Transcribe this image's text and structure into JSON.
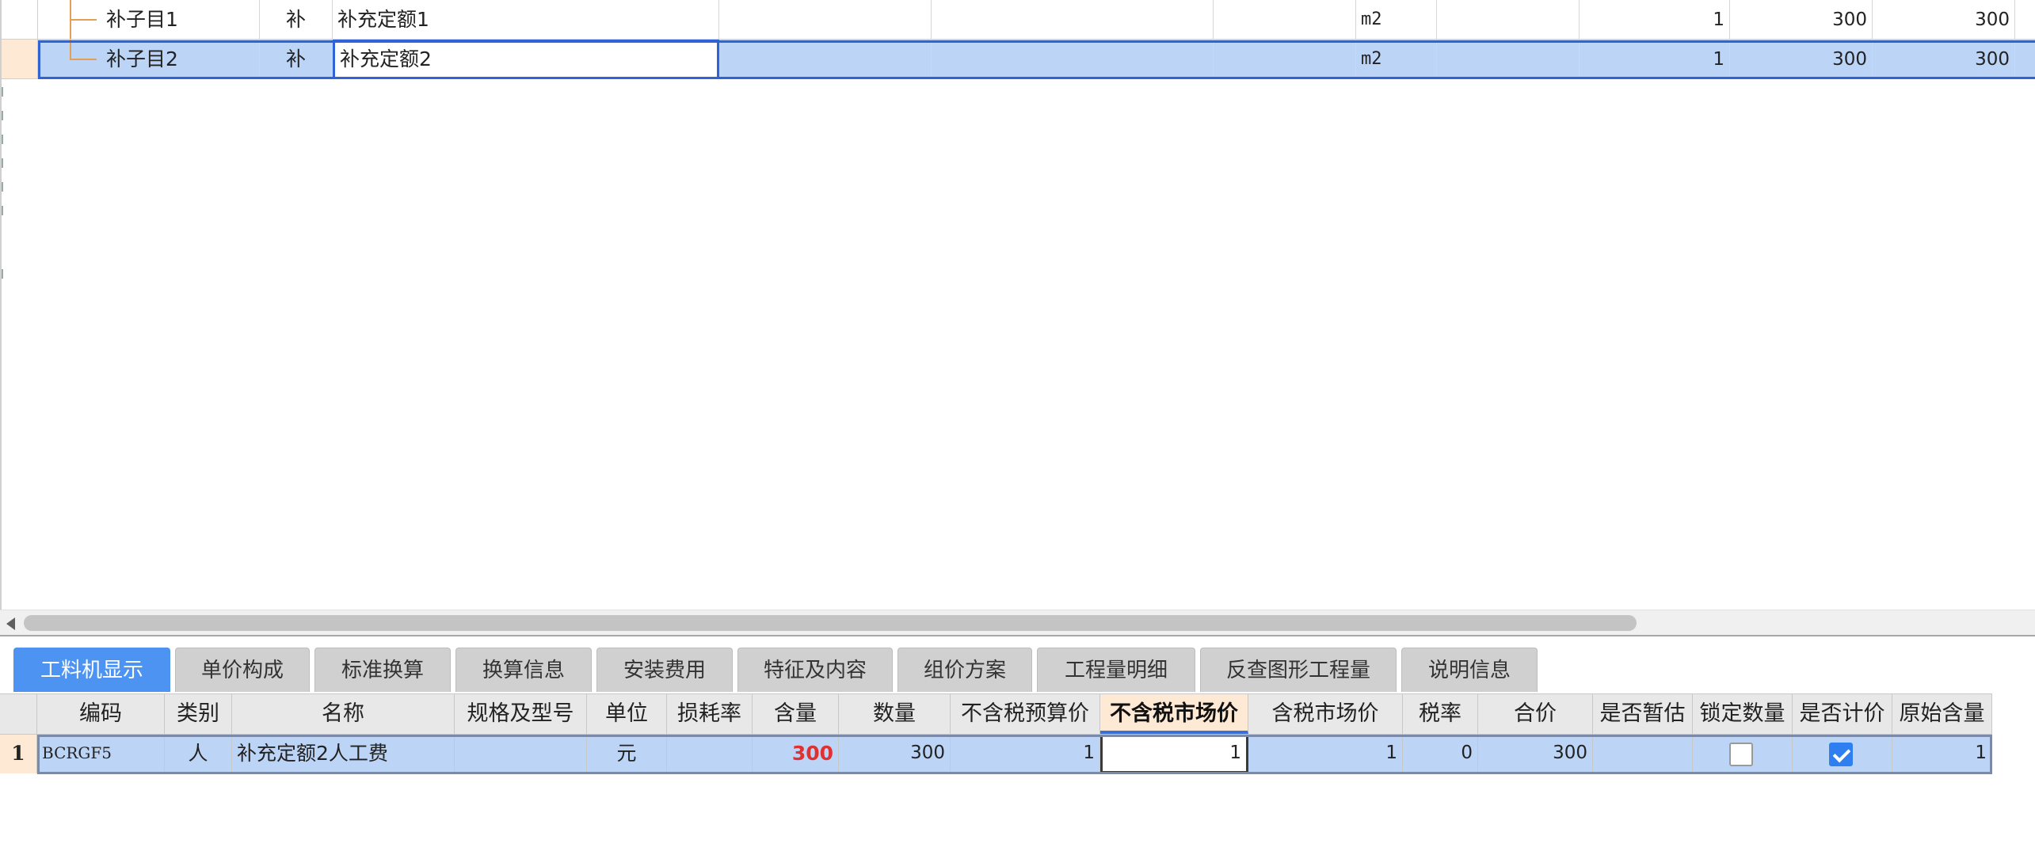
{
  "top_grid": {
    "rows": [
      {
        "name": "补子目1",
        "type": "补",
        "desc": "补充定额1",
        "unit": "m2",
        "qty": "1",
        "price": "300",
        "total": "300"
      },
      {
        "name": "补子目2",
        "type": "补",
        "desc": "补充定额2",
        "unit": "m2",
        "qty": "1",
        "price": "300",
        "total": "300"
      }
    ]
  },
  "tabs": [
    {
      "label": "工料机显示",
      "active": true
    },
    {
      "label": "单价构成"
    },
    {
      "label": "标准换算"
    },
    {
      "label": "换算信息"
    },
    {
      "label": "安装费用"
    },
    {
      "label": "特征及内容"
    },
    {
      "label": "组价方案"
    },
    {
      "label": "工程量明细"
    },
    {
      "label": "反查图形工程量"
    },
    {
      "label": "说明信息"
    }
  ],
  "labor_grid": {
    "headers": {
      "code": "编码",
      "category": "类别",
      "name": "名称",
      "spec": "规格及型号",
      "unit": "单位",
      "loss_rate": "损耗率",
      "content": "含量",
      "quantity": "数量",
      "budget_price_ex_tax": "不含税预算价",
      "market_price_ex_tax": "不含税市场价",
      "market_price_inc_tax": "含税市场价",
      "tax_rate": "税率",
      "total": "合价",
      "is_provisional": "是否暂估",
      "lock_qty": "锁定数量",
      "is_priced": "是否计价",
      "original_content": "原始含量"
    },
    "rows": [
      {
        "index": "1",
        "code": "BCRGF5",
        "category": "人",
        "name": "补充定额2人工费",
        "spec": "",
        "unit": "元",
        "loss_rate": "",
        "content": "300",
        "quantity": "300",
        "budget_price_ex_tax": "1",
        "market_price_ex_tax": "1",
        "market_price_inc_tax": "1",
        "tax_rate": "0",
        "total": "300",
        "is_provisional": "",
        "lock_qty": false,
        "is_priced": true,
        "original_content": "1"
      }
    ]
  }
}
